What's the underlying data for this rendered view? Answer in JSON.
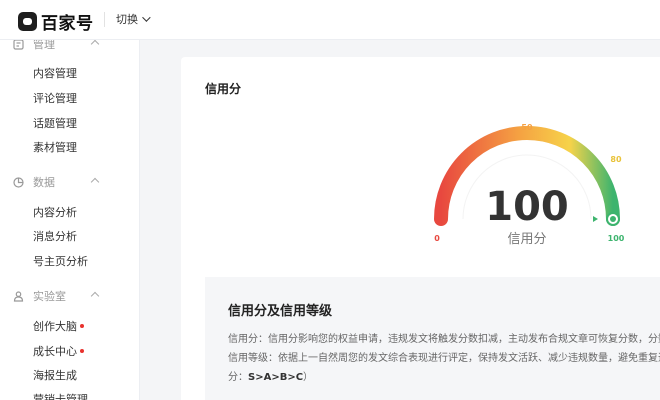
{
  "header": {
    "brand": "百家号",
    "switch_label": "切换"
  },
  "sidebar": {
    "sections": [
      {
        "label": "管理",
        "icon": "manage-icon",
        "items": [
          "内容管理",
          "评论管理",
          "话题管理",
          "素材管理"
        ]
      },
      {
        "label": "数据",
        "icon": "pie-chart-icon",
        "items": [
          "内容分析",
          "消息分析",
          "号主页分析"
        ]
      },
      {
        "label": "实验室",
        "icon": "lab-icon",
        "items": [
          "创作大脑",
          "成长中心",
          "海报生成",
          "营销卡管理"
        ]
      }
    ]
  },
  "credit": {
    "title": "信用分",
    "score": "100",
    "score_label": "信用分",
    "gauge_fraction": 1.0,
    "ticks": {
      "min": "0",
      "mid": "50",
      "high": "80",
      "max": "100"
    },
    "colors": {
      "low": "#e8483f",
      "mid": "#f5a142",
      "high": "#f6d34a",
      "top": "#3db46e"
    }
  },
  "info": {
    "title": "信用分及信用等级",
    "line1": "信用分：信用分影响您的权益申请，违规发文将触发分数扣减，主动发布合规文章可恢复分数，分数",
    "line2": "信用等级：依据上一自然周您的发文综合表现进行评定，保持发文活跃、减少违规数量，避免重复违",
    "line3_prefix": "分：",
    "line3_grades": "S>A>B>C",
    "line3_suffix": "）"
  }
}
